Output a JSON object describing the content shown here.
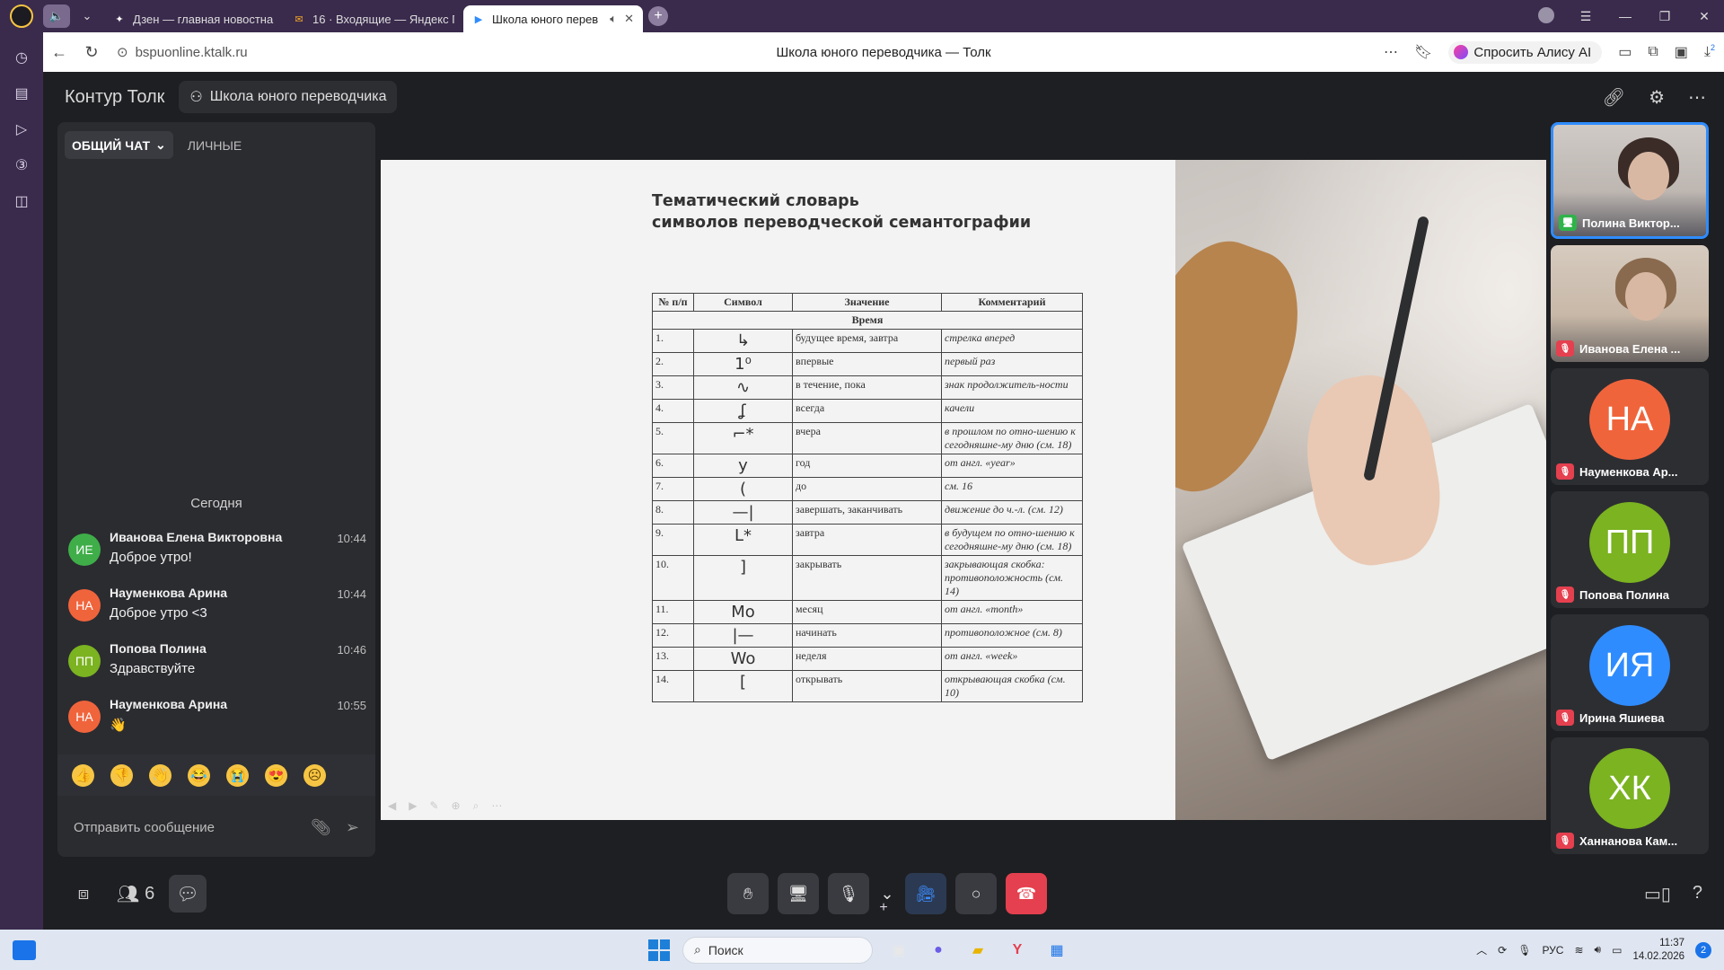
{
  "browser": {
    "tabs": [
      {
        "label": "Дзен — главная новостна",
        "icon": "star-icon"
      },
      {
        "label": "16 · Входящие — Яндекс Г",
        "icon": "mail-icon"
      },
      {
        "label": "Школа юного перев",
        "icon": "video-icon",
        "active": true
      }
    ],
    "address_url": "bspuonline.ktalk.ru",
    "page_title": "Школа юного переводчика — Толк",
    "alisa_label": "Спросить Алису AI",
    "downloads_badge": "2"
  },
  "app": {
    "brand": "Контур Толк",
    "room_name": "Школа юного переводчика"
  },
  "chat": {
    "tab_general": "ОБЩИЙ ЧАТ",
    "tab_private": "ЛИЧНЫЕ",
    "date_separator": "Сегодня",
    "messages": [
      {
        "initials": "ИЕ",
        "color": "#3fae49",
        "author": "Иванова Елена Викторовна",
        "time": "10:44",
        "text": "Доброе утро!"
      },
      {
        "initials": "НА",
        "color": "#f0643c",
        "author": "Науменкова Арина",
        "time": "10:44",
        "text": "Доброе утро <3"
      },
      {
        "initials": "ПП",
        "color": "#7bb321",
        "author": "Попова Полина",
        "time": "10:46",
        "text": "Здравствуйте"
      },
      {
        "initials": "НА",
        "color": "#f0643c",
        "author": "Науменкова Арина",
        "time": "10:55",
        "text": "👋"
      }
    ],
    "reactions": [
      "👍",
      "👎",
      "👋",
      "😂",
      "😭",
      "😍",
      "☹"
    ],
    "input_placeholder": "Отправить сообщение"
  },
  "slide": {
    "title_line1": "Тематический словарь",
    "title_line2": "символов переводческой семантографии",
    "columns": [
      "№ п/п",
      "Символ",
      "Значение",
      "Комментарий"
    ],
    "section": "Время",
    "rows": [
      {
        "num": "1.",
        "sym": "↳",
        "mean": "будущее время, завтра",
        "com": "стрелка вперед"
      },
      {
        "num": "2.",
        "sym": "1⁰",
        "mean": "впервые",
        "com": "первый раз"
      },
      {
        "num": "3.",
        "sym": "∿",
        "mean": "в течение, пока",
        "com": "знак продолжитель-ности"
      },
      {
        "num": "4.",
        "sym": "ʆ",
        "mean": "всегда",
        "com": "качели"
      },
      {
        "num": "5.",
        "sym": "⌐*",
        "mean": "вчера",
        "com": "в прошлом по отно-шению к сегодняшне-му дню (см. 18)"
      },
      {
        "num": "6.",
        "sym": "y",
        "mean": "год",
        "com": "от англ. «year»"
      },
      {
        "num": "7.",
        "sym": "(",
        "mean": "до",
        "com": "см. 16"
      },
      {
        "num": "8.",
        "sym": "—|",
        "mean": "завершать, заканчивать",
        "com": "движение до ч.-л. (см. 12)"
      },
      {
        "num": "9.",
        "sym": "ᒪ*",
        "mean": "завтра",
        "com": "в будущем по отно-шению к сегодняшне-му дню (см. 18)"
      },
      {
        "num": "10.",
        "sym": "]",
        "mean": "закрывать",
        "com": "закрывающая скобка: противоположность (см. 14)"
      },
      {
        "num": "11.",
        "sym": "Mo",
        "mean": "месяц",
        "com": "от англ. «month»"
      },
      {
        "num": "12.",
        "sym": "|—",
        "mean": "начинать",
        "com": "противоположное (см. 8)"
      },
      {
        "num": "13.",
        "sym": "Wo",
        "mean": "неделя",
        "com": "от англ. «week»"
      },
      {
        "num": "14.",
        "sym": "[",
        "mean": "открывать",
        "com": "открывающая скобка (см. 10)"
      }
    ]
  },
  "participants": [
    {
      "name": "Полина Виктор...",
      "type": "video",
      "badge": "screen",
      "active": true
    },
    {
      "name": "Иванова Елена ...",
      "type": "video2",
      "badge": "mic-off"
    },
    {
      "name": "Науменкова Ар...",
      "initials": "НА",
      "color": "#f0643c",
      "badge": "mic-off"
    },
    {
      "name": "Попова Полина",
      "initials": "ПП",
      "color": "#7bb321",
      "badge": "mic-off"
    },
    {
      "name": "Ирина Яшиева",
      "initials": "ИЯ",
      "color": "#2f8cff",
      "badge": "mic-off"
    },
    {
      "name": "Ханнанова Кам...",
      "initials": "ХК",
      "color": "#7bb321",
      "badge": "mic-off"
    }
  ],
  "controls": {
    "participants_count": "6"
  },
  "taskbar": {
    "search_placeholder": "Поиск",
    "lang": "РУС",
    "time": "11:37",
    "date": "14.02.2026",
    "notifications": "2"
  }
}
